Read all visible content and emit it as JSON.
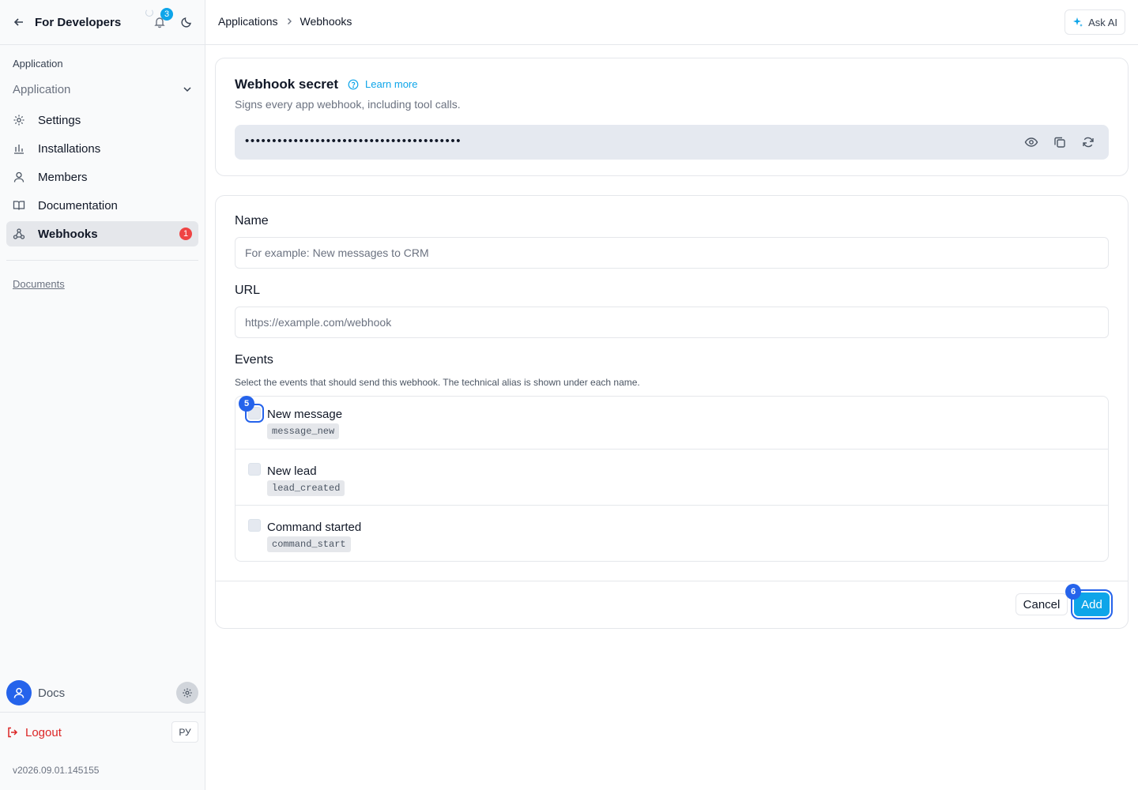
{
  "sidebar": {
    "title": "For Developers",
    "notifications_count": "3",
    "section_label": "Application",
    "app_select": "Application",
    "items": [
      {
        "label": "Settings",
        "icon": "gear-icon"
      },
      {
        "label": "Installations",
        "icon": "bar-chart-icon"
      },
      {
        "label": "Members",
        "icon": "user-icon"
      },
      {
        "label": "Documentation",
        "icon": "book-icon"
      },
      {
        "label": "Webhooks",
        "icon": "webhook-icon",
        "badge": "1",
        "active": true
      }
    ],
    "docs_link": "Documents",
    "user_name": "Docs",
    "logout": "Logout",
    "lang": "РУ",
    "version": "v2026.09.01.145155"
  },
  "topbar": {
    "breadcrumb": [
      "Applications",
      "Webhooks"
    ],
    "ask_ai": "Ask AI"
  },
  "secret": {
    "title": "Webhook secret",
    "learn_more": "Learn more",
    "subtitle": "Signs every app webhook, including tool calls.",
    "masked_value": "••••••••••••••••••••••••••••••••••••••••"
  },
  "form": {
    "name_label": "Name",
    "name_placeholder": "For example: New messages to CRM",
    "url_label": "URL",
    "url_placeholder": "https://example.com/webhook",
    "events_label": "Events",
    "events_hint": "Select the events that should send this webhook. The technical alias is shown under each name.",
    "events": [
      {
        "name": "New message",
        "alias": "message_new",
        "checked": false
      },
      {
        "name": "New lead",
        "alias": "lead_created",
        "checked": false
      },
      {
        "name": "Command started",
        "alias": "command_start",
        "checked": false
      }
    ],
    "cancel": "Cancel",
    "add": "Add"
  },
  "markers": {
    "checkbox": "5",
    "add": "6"
  },
  "colors": {
    "accent": "#0ea5e9",
    "focus": "#2563eb",
    "danger": "#dc2626"
  }
}
